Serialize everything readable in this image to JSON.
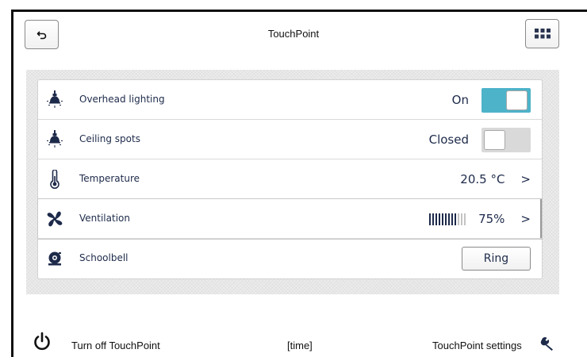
{
  "header": {
    "title": "TouchPoint",
    "back_icon": "undo-arrow-icon",
    "menu_icon": "grid-menu-icon"
  },
  "rows": [
    {
      "label": "Overhead lighting",
      "value": "On",
      "control": "toggle",
      "state": true,
      "icon": "bulb-icon"
    },
    {
      "label": "Ceiling spots",
      "value": "Closed",
      "control": "toggle",
      "state": false,
      "icon": "bulb-icon"
    },
    {
      "label": "Temperature",
      "value": "20.5 °C",
      "control": "chevron",
      "icon": "thermometer-icon"
    },
    {
      "label": "Ventilation",
      "value": "75%",
      "control": "chevron",
      "level": 0.75,
      "icon": "fan-icon"
    },
    {
      "label": "Schoolbell",
      "button": "Ring",
      "control": "button",
      "icon": "bell-icon"
    }
  ],
  "footer": {
    "power_label": "Turn off TouchPoint",
    "time_label": "[time]",
    "settings_label": "TouchPoint settings",
    "power_icon": "power-icon",
    "settings_icon": "wrench-icon"
  },
  "colors": {
    "accent": "#4db3c9",
    "text_dark": "#1d2a4a",
    "toggle_off": "#d9d9d9"
  }
}
